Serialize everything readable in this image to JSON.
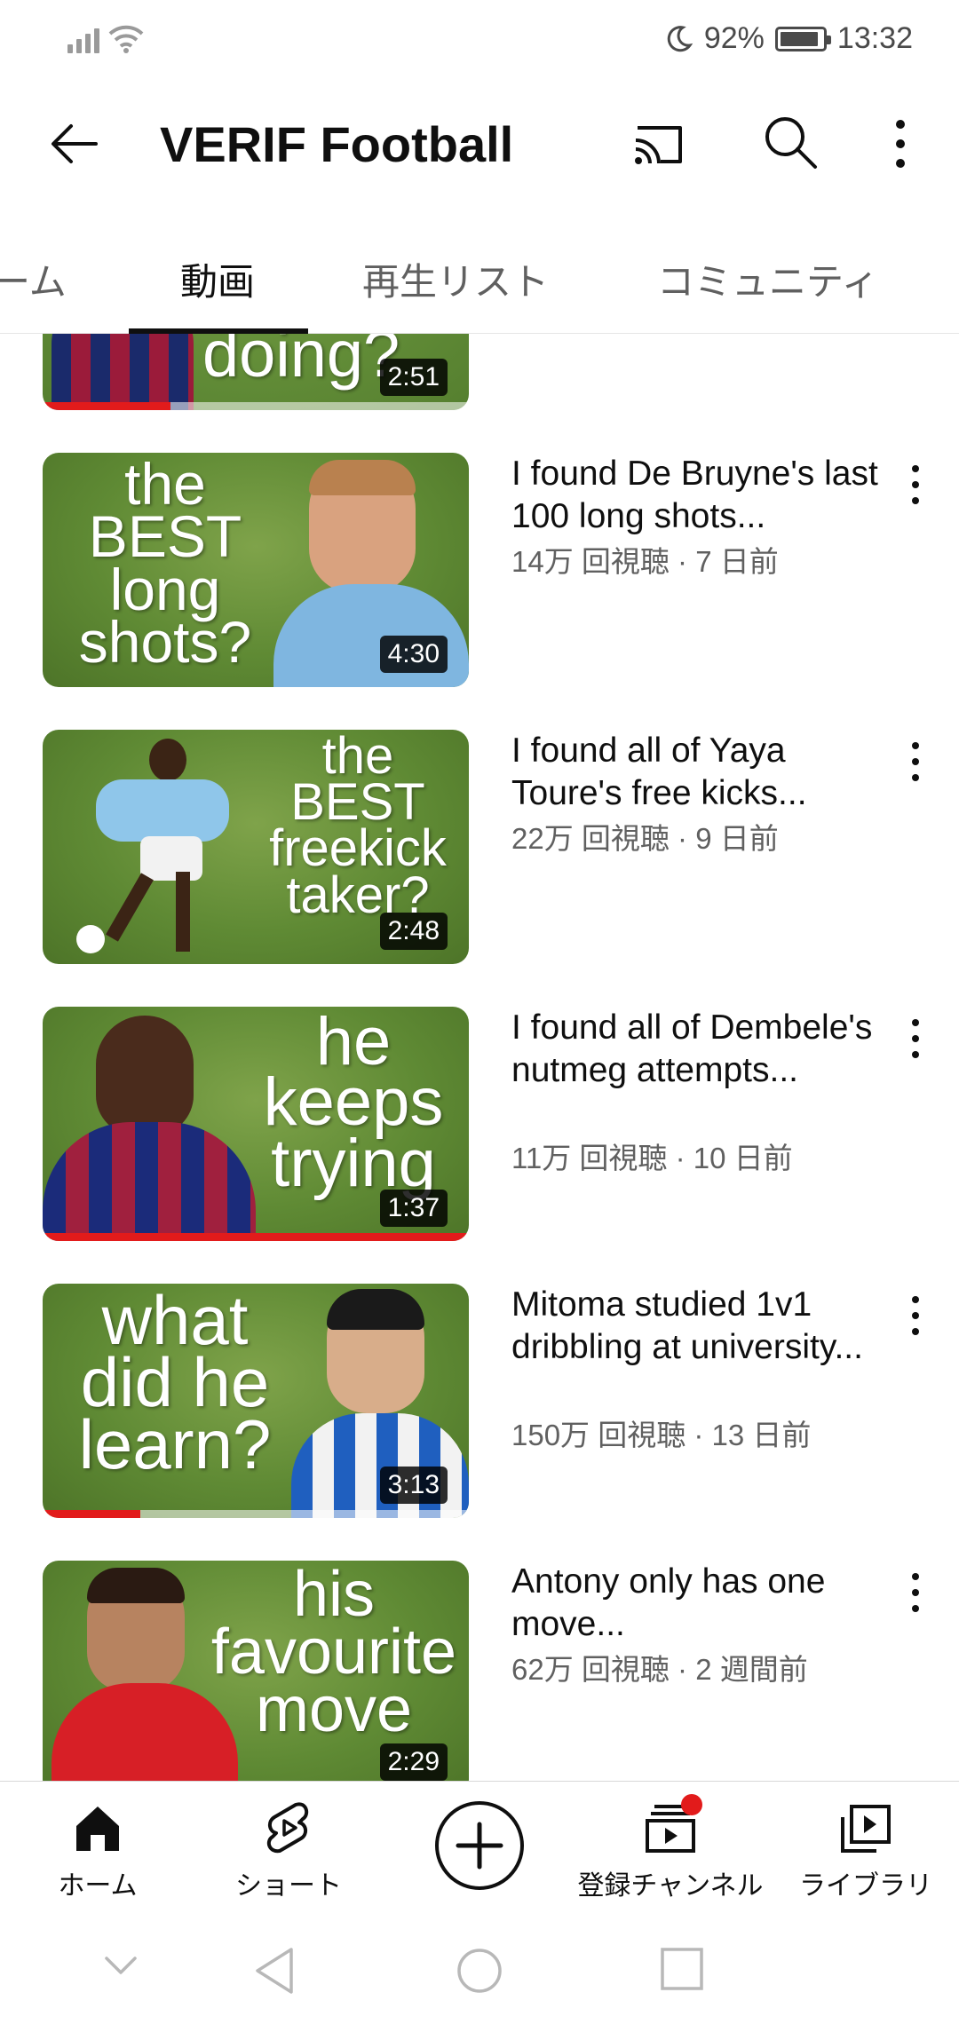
{
  "status_bar": {
    "battery_text": "92%",
    "time": "13:32",
    "icons": [
      "signal-icon",
      "wifi-icon",
      "moon-icon",
      "battery-icon"
    ]
  },
  "header": {
    "title": "VERIF Football",
    "icons": [
      "back-arrow-icon",
      "cast-icon",
      "search-icon",
      "more-vert-icon"
    ]
  },
  "tabs": [
    {
      "label": "ーム",
      "active": false
    },
    {
      "label": "動画",
      "active": true
    },
    {
      "label": "再生リスト",
      "active": false
    },
    {
      "label": "コミュニティ",
      "active": false
    }
  ],
  "videos": [
    {
      "title": "",
      "meta": "",
      "duration": "2:51",
      "thumb_text": "doing?",
      "progress": 0.3
    },
    {
      "title": "I found De Bruyne's last 100 long shots...",
      "meta": "14万 回視聴 · 7 日前",
      "duration": "4:30",
      "thumb_text": "the\nBEST\nlong\nshots?",
      "progress": 0
    },
    {
      "title": "I found all of Yaya Toure's free kicks...",
      "meta": "22万 回視聴 · 9 日前",
      "duration": "2:48",
      "thumb_text": "the\nBEST\nfreekick\ntaker?",
      "progress": 0
    },
    {
      "title": "I found all of Dembele's nutmeg attempts...",
      "meta": "11万 回視聴 · 10 日前",
      "duration": "1:37",
      "thumb_text": "he\nkeeps\ntrying",
      "progress": 1.0
    },
    {
      "title": "Mitoma studied 1v1 dribbling at university...",
      "meta": "150万 回視聴 · 13 日前",
      "duration": "3:13",
      "thumb_text": "what\ndid he\nlearn?",
      "progress": 0.23
    },
    {
      "title": "Antony only has one move...",
      "meta": "62万 回視聴 · 2 週間前",
      "duration": "2:29",
      "thumb_text": "his\nfavourite\nmove",
      "progress": 0
    }
  ],
  "bottom_nav": [
    {
      "label": "ホーム",
      "icon": "home-icon"
    },
    {
      "label": "ショート",
      "icon": "shorts-icon"
    },
    {
      "label": "",
      "icon": "create-plus-icon"
    },
    {
      "label": "登録チャンネル",
      "icon": "subscriptions-icon",
      "badge": true
    },
    {
      "label": "ライブラリ",
      "icon": "library-icon"
    }
  ],
  "system_nav": [
    "collapse-icon",
    "back-triangle-icon",
    "home-circle-icon",
    "recents-square-icon"
  ],
  "colors": {
    "accent_red": "#e21b1b",
    "text_primary": "#0f0f0f",
    "text_secondary": "#606060",
    "thumb_green": "#5f8a34"
  }
}
